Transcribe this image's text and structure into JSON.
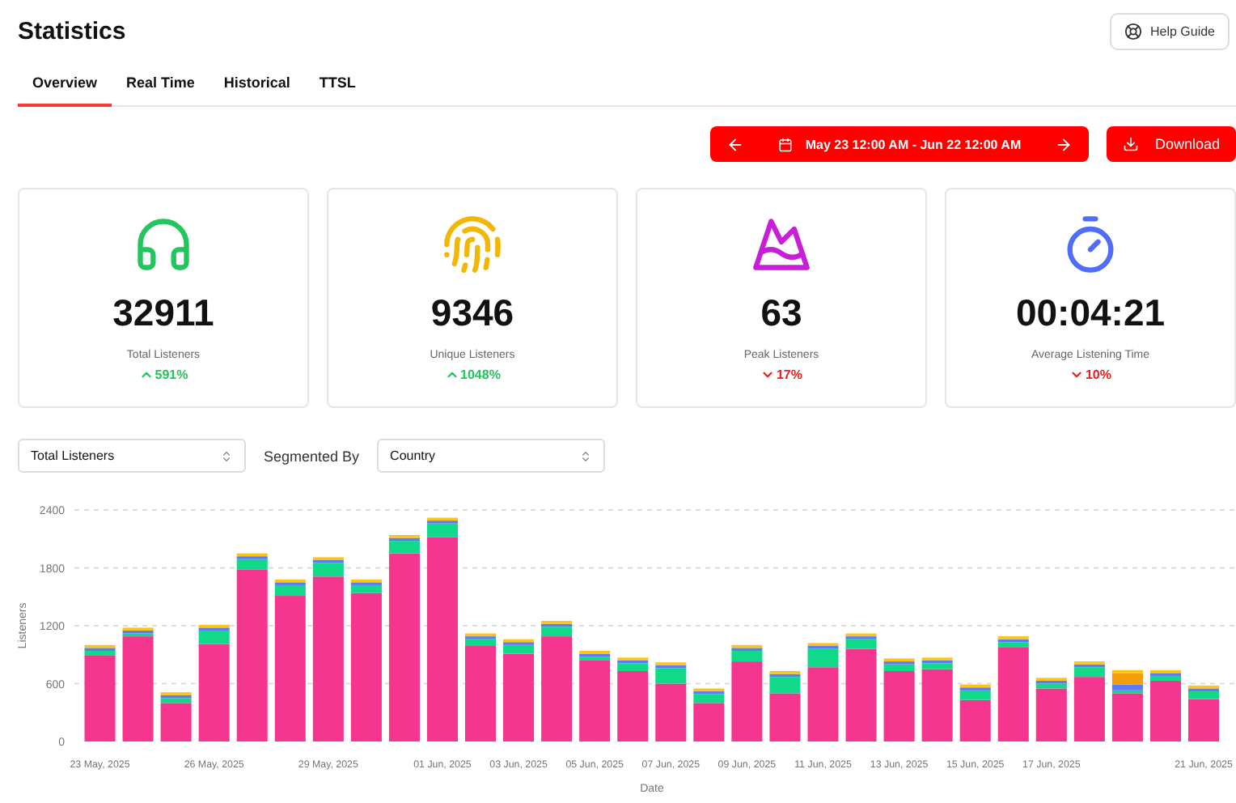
{
  "title": "Statistics",
  "help_button": {
    "label": "Help Guide"
  },
  "tabs": [
    {
      "label": "Overview",
      "selected": true
    },
    {
      "label": "Real Time",
      "selected": false
    },
    {
      "label": "Historical",
      "selected": false
    },
    {
      "label": "TTSL",
      "selected": false
    }
  ],
  "date_range": {
    "label": "May 23 12:00 AM - Jun 22 12:00 AM"
  },
  "download_button": {
    "label": "Download"
  },
  "stats": [
    {
      "kind": "headphones",
      "color": "#22c55e",
      "value": "32911",
      "label": "Total Listeners",
      "change": "591%",
      "rising": true
    },
    {
      "kind": "fingerprint",
      "color": "#f2b705",
      "value": "9346",
      "label": "Unique Listeners",
      "change": "1048%",
      "rising": true
    },
    {
      "kind": "mountain",
      "color": "#c81fd6",
      "value": "63",
      "label": "Peak Listeners",
      "change": "17%",
      "rising": false
    },
    {
      "kind": "timer",
      "color": "#4f6ef7",
      "value": "00:04:21",
      "label": "Average Listening Time",
      "change": "10%",
      "rising": false
    }
  ],
  "filters": {
    "metric": {
      "value": "Total Listeners"
    },
    "segment_label": "Segmented By",
    "segment": {
      "value": "Country"
    }
  },
  "chart_data": {
    "type": "bar",
    "stacked": true,
    "grid": true,
    "xlabel": "Date",
    "ylabel": "Listeners",
    "categories": [
      "23 May, 2025",
      null,
      null,
      "26 May, 2025",
      null,
      null,
      "29 May, 2025",
      null,
      null,
      "01 Jun, 2025",
      null,
      "03 Jun, 2025",
      null,
      "05 Jun, 2025",
      null,
      "07 Jun, 2025",
      null,
      "09 Jun, 2025",
      null,
      "11 Jun, 2025",
      null,
      "13 Jun, 2025",
      null,
      "15 Jun, 2025",
      null,
      "17 Jun, 2025",
      null,
      null,
      null,
      "21 Jun, 2025"
    ],
    "ylim": [
      0,
      2400
    ],
    "yticks": [
      0,
      600,
      1200,
      1800,
      2400
    ],
    "series": [
      {
        "color": "#f5368f",
        "values": [
          890,
          1090,
          400,
          1010,
          1780,
          1510,
          1710,
          1540,
          1950,
          2120,
          990,
          910,
          1090,
          840,
          730,
          600,
          400,
          830,
          500,
          770,
          960,
          730,
          750,
          430,
          980,
          550,
          670,
          500,
          630,
          440
        ]
      },
      {
        "color": "#10d98a",
        "values": [
          50,
          30,
          50,
          140,
          110,
          110,
          140,
          80,
          130,
          140,
          70,
          90,
          100,
          40,
          80,
          160,
          90,
          110,
          170,
          190,
          100,
          70,
          60,
          100,
          50,
          50,
          100,
          30,
          50,
          80
        ]
      },
      {
        "color": "#5b7cf7",
        "values": [
          30,
          30,
          30,
          30,
          30,
          30,
          30,
          30,
          30,
          30,
          30,
          30,
          30,
          30,
          30,
          30,
          30,
          30,
          30,
          30,
          30,
          30,
          30,
          30,
          30,
          30,
          30,
          60,
          30,
          30
        ]
      },
      {
        "color": "#f59e0b",
        "values": [
          0,
          0,
          0,
          0,
          0,
          0,
          0,
          0,
          0,
          0,
          0,
          0,
          0,
          0,
          0,
          0,
          0,
          0,
          0,
          0,
          0,
          0,
          0,
          0,
          0,
          0,
          0,
          120,
          0,
          0
        ]
      },
      {
        "color": "#fcc419",
        "values": [
          30,
          30,
          30,
          30,
          30,
          30,
          30,
          30,
          30,
          30,
          30,
          30,
          30,
          30,
          30,
          30,
          30,
          30,
          30,
          30,
          30,
          30,
          30,
          30,
          30,
          30,
          30,
          30,
          30,
          30
        ]
      }
    ]
  }
}
